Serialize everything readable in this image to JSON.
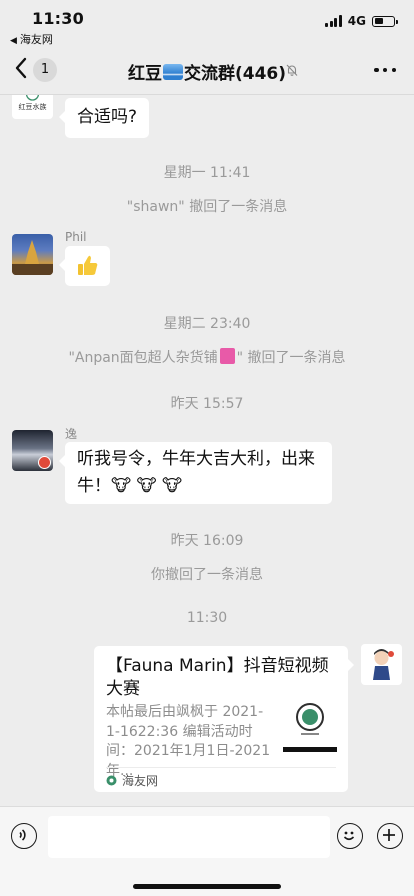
{
  "status_bar": {
    "time": "11:30",
    "back_app": "海友网",
    "network": "4G",
    "battery_level": 0.45
  },
  "nav": {
    "back_count": "1",
    "title_before_emoji": "红豆",
    "title_after_emoji": "交流群(446)"
  },
  "messages": [
    {
      "type": "text",
      "side": "left",
      "text": "合适吗?"
    },
    {
      "type": "system",
      "text": "星期一 11:41"
    },
    {
      "type": "system",
      "text": "\"shawn\" 撤回了一条消息"
    },
    {
      "type": "sticker",
      "side": "left",
      "sender": "Phil"
    },
    {
      "type": "system",
      "text": "星期二 23:40"
    },
    {
      "type": "system",
      "text_before": "\"Anpan面包超人杂货铺",
      "text_after": "\" 撤回了一条消息"
    },
    {
      "type": "system",
      "text": "昨天 15:57"
    },
    {
      "type": "text",
      "side": "left",
      "sender": "逸",
      "text": "听我号令，牛年大吉大利，出来牛！🐮 🐮 🐮"
    },
    {
      "type": "system",
      "text": "昨天 16:09"
    },
    {
      "type": "system",
      "text": "你撤回了一条消息"
    },
    {
      "type": "system",
      "text": "11:30"
    },
    {
      "type": "link_card",
      "side": "right",
      "title": "【Fauna Marin】抖音短视频大赛",
      "description": "本帖最后由飒枫于 2021-1-1622:36 编辑活动时间：2021年1月1日-2021年...",
      "source": "海友网"
    }
  ],
  "avatars": {
    "hongdou_logo_text": "红豆水族"
  },
  "input": {
    "placeholder": ""
  },
  "colors": {
    "background": "#ededed",
    "bubble": "#ffffff",
    "system_text": "#9a9a9a",
    "badge": "#e04a3a"
  }
}
